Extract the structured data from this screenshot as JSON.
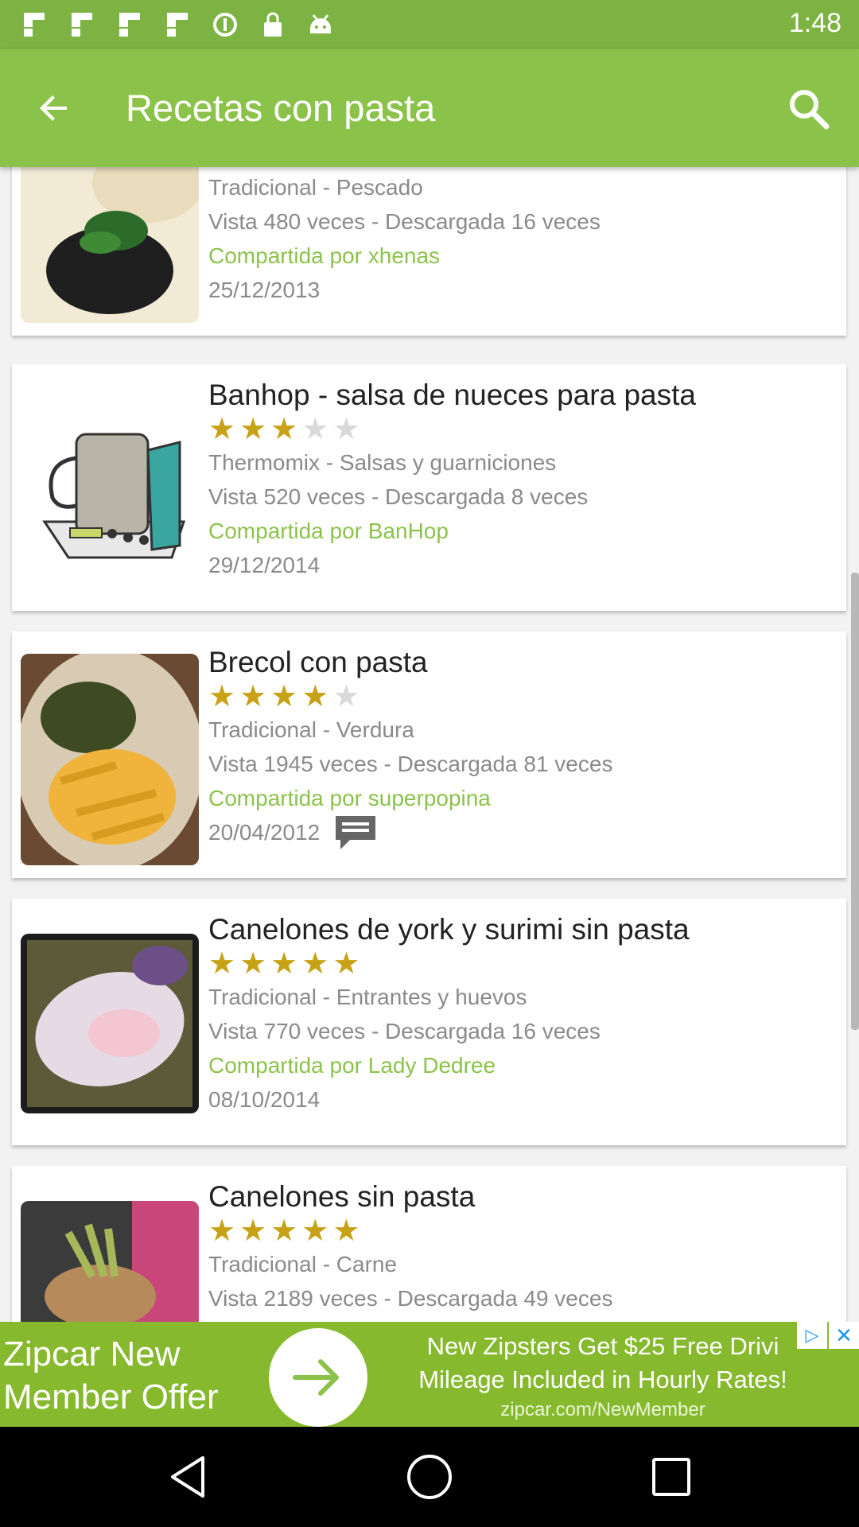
{
  "status_bar": {
    "time": "1:48",
    "icons": [
      "flipboard-icon",
      "flipboard-icon",
      "flipboard-icon",
      "flipboard-icon",
      "data-saver-icon",
      "lock-icon",
      "android-debug-icon"
    ]
  },
  "app_bar": {
    "title": "Recetas con pasta",
    "back_icon": "arrow-back-icon",
    "search_icon": "search-icon"
  },
  "colors": {
    "primary": "#8bc34a",
    "status_bar": "#7cb342",
    "star": "#c8a216",
    "star_off": "#d9d9d9",
    "shared_by_text": "#8bc34a"
  },
  "recipes": [
    {
      "title": "",
      "rating": 0,
      "category": "Tradicional - Pescado",
      "stats": "Vista 480 veces - Descargada 16 veces",
      "shared_by": "Compartida por xhenas",
      "date": "25/12/2013",
      "has_comments": false
    },
    {
      "title": "Banhop - salsa de nueces para pasta",
      "rating": 3,
      "category": "Thermomix - Salsas y guarniciones",
      "stats": "Vista 520 veces - Descargada 8 veces",
      "shared_by": "Compartida por BanHop",
      "date": "29/12/2014",
      "has_comments": false
    },
    {
      "title": "Brecol con pasta",
      "rating": 4,
      "category": "Tradicional - Verdura",
      "stats": "Vista 1945 veces - Descargada 81 veces",
      "shared_by": "Compartida por superpopina",
      "date": "20/04/2012",
      "has_comments": true
    },
    {
      "title": "Canelones de york y surimi sin pasta",
      "rating": 5,
      "category": "Tradicional - Entrantes y huevos",
      "stats": "Vista 770 veces - Descargada 16 veces",
      "shared_by": "Compartida por Lady Dedree",
      "date": "08/10/2014",
      "has_comments": false
    },
    {
      "title": "Canelones sin pasta",
      "rating": 5,
      "category": "Tradicional - Carne",
      "stats": "Vista 2189 veces - Descargada 49 veces",
      "shared_by": "",
      "date": "",
      "has_comments": false
    }
  ],
  "ad": {
    "left_text": "Zipcar New Member Offer",
    "headline": "New Zipsters Get $25 Free Drivi",
    "subline": "Mileage Included in Hourly Rates!",
    "url": "zipcar.com/NewMember"
  },
  "nav_bar": {
    "back_icon": "back-triangle-icon",
    "home_icon": "home-circle-icon",
    "recents_icon": "recents-square-icon"
  }
}
